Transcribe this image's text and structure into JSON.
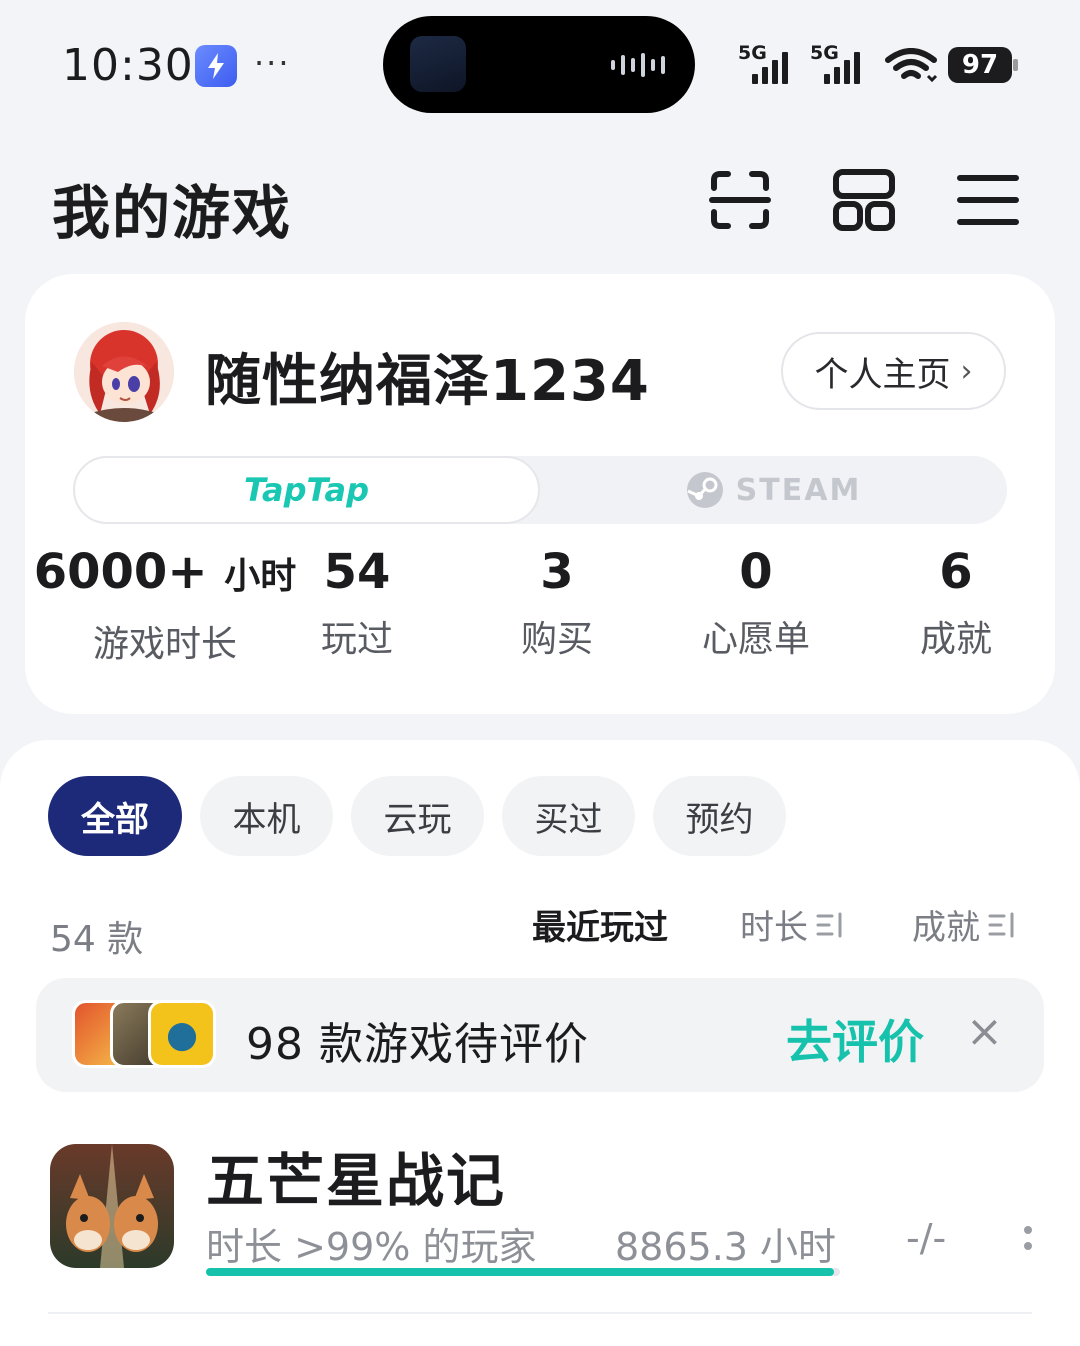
{
  "status_bar": {
    "time": "10:30",
    "network_1": "5G",
    "network_2": "5G",
    "battery": "97",
    "battery_level_percent": 97
  },
  "header": {
    "title": "我的游戏",
    "icons": [
      "scan-icon",
      "grid-icon",
      "menu-icon"
    ]
  },
  "profile": {
    "username": "随性纳福泽1234",
    "homepage_button": "个人主页",
    "platforms": {
      "active": "TapTap",
      "inactive": "STEAM"
    },
    "stats": [
      {
        "value": "6000+",
        "unit": "小时",
        "label": "游戏时长"
      },
      {
        "value": "54",
        "unit": "",
        "label": "玩过"
      },
      {
        "value": "3",
        "unit": "",
        "label": "购买"
      },
      {
        "value": "0",
        "unit": "",
        "label": "心愿单"
      },
      {
        "value": "6",
        "unit": "",
        "label": "成就"
      }
    ]
  },
  "filters": {
    "chips": [
      "全部",
      "本机",
      "云玩",
      "买过",
      "预约"
    ],
    "selected": "全部"
  },
  "list": {
    "count": "54 款",
    "sort_options": [
      "最近玩过",
      "时长",
      "成就"
    ],
    "active_sort": "最近玩过"
  },
  "review_banner": {
    "text": "98 款游戏待评价",
    "action": "去评价"
  },
  "games": [
    {
      "name": "五芒星战记",
      "meta": "时长 >99% 的玩家",
      "hours": "8865.3 小时",
      "achievements": "-/-",
      "progress_percent": 99
    }
  ],
  "colors": {
    "accent": "#17c2ad",
    "chip_active": "#1d2a7a",
    "background": "#f3f4f7"
  }
}
